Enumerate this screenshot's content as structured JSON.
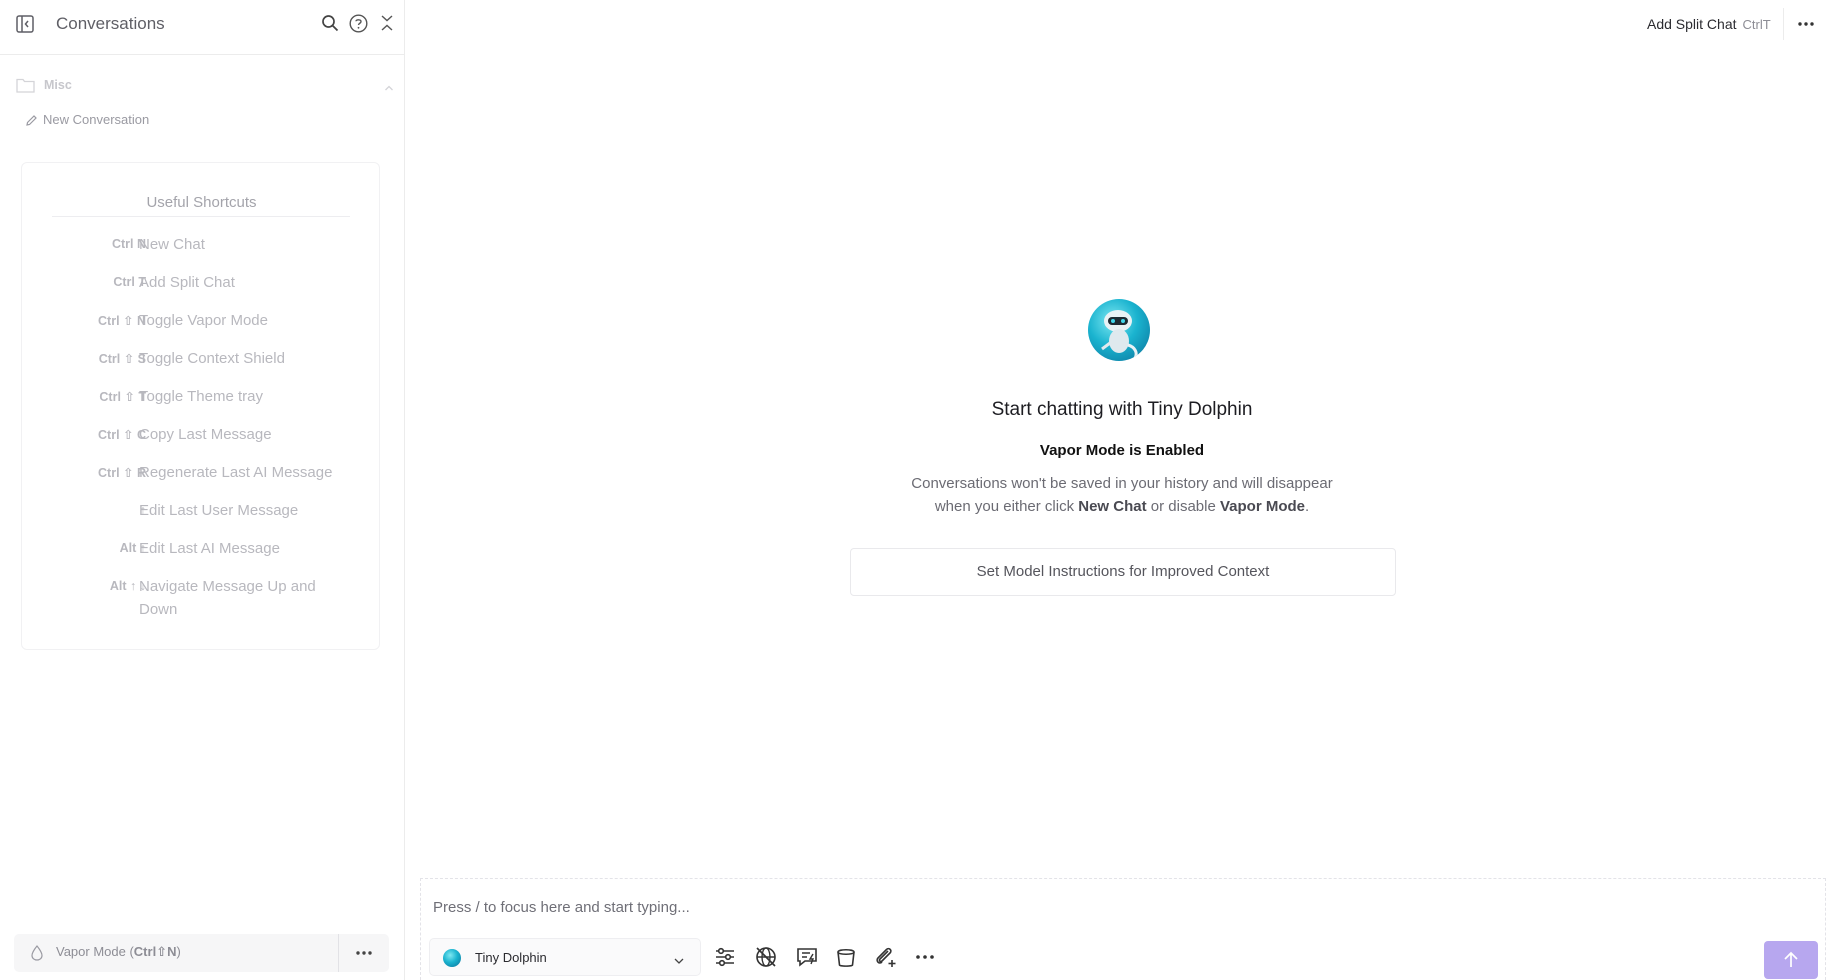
{
  "sidebar": {
    "title": "Conversations",
    "folder": {
      "label": "Misc"
    },
    "new_conversation_label": "New Conversation",
    "shortcuts": {
      "title": "Useful Shortcuts",
      "items": [
        {
          "key": "Ctrl N",
          "label": "New Chat"
        },
        {
          "key": "Ctrl T",
          "label": "Add Split Chat"
        },
        {
          "key": "Ctrl ⇧ N",
          "label": "Toggle Vapor Mode"
        },
        {
          "key": "Ctrl ⇧ S",
          "label": "Toggle Context Shield"
        },
        {
          "key": "Ctrl ⇧ T",
          "label": "Toggle Theme tray"
        },
        {
          "key": "Ctrl ⇧ C",
          "label": "Copy Last Message"
        },
        {
          "key": "Ctrl ⇧ R",
          "label": "Regenerate Last AI Message"
        },
        {
          "key": "↑",
          "label": "Edit Last User Message"
        },
        {
          "key": "Alt ↑",
          "label": "Edit Last AI Message"
        },
        {
          "key": "Alt ↑ ↓",
          "label": "Navigate Message Up and Down"
        }
      ]
    },
    "vapor": {
      "prefix": "Vapor Mode (",
      "key": "Ctrl⇧N",
      "suffix": ")"
    }
  },
  "topbar": {
    "split_label": "Add Split Chat",
    "split_key": "CtrlT"
  },
  "main": {
    "hero_title": "Start chatting with Tiny Dolphin",
    "vapor_enabled": "Vapor Mode is Enabled",
    "desc_1": "Conversations won't be saved in your history and will disappear",
    "desc_2": "when you either click ",
    "desc_new_chat": "New Chat",
    "desc_3": " or disable ",
    "desc_vapor": "Vapor Mode",
    "desc_4": ".",
    "model_instructions": "Set Model Instructions for Improved Context"
  },
  "composer": {
    "placeholder": "Press / to focus here and start typing...",
    "value": "",
    "model_name": "Tiny Dolphin"
  },
  "colors": {
    "send_button": "#b7a7ef",
    "accent_dolphin": "#1ab3cf"
  },
  "icons": [
    "sidebar-toggle-icon",
    "search-icon",
    "help-icon",
    "collapse-icon",
    "folder-icon",
    "chevron-up-icon",
    "pencil-icon",
    "vapor-drop-icon",
    "more-icon",
    "chevron-down-icon",
    "sliders-icon",
    "globe-off-icon",
    "chat-bolt-icon",
    "bucket-icon",
    "attach-plus-icon",
    "arrow-up-icon"
  ]
}
